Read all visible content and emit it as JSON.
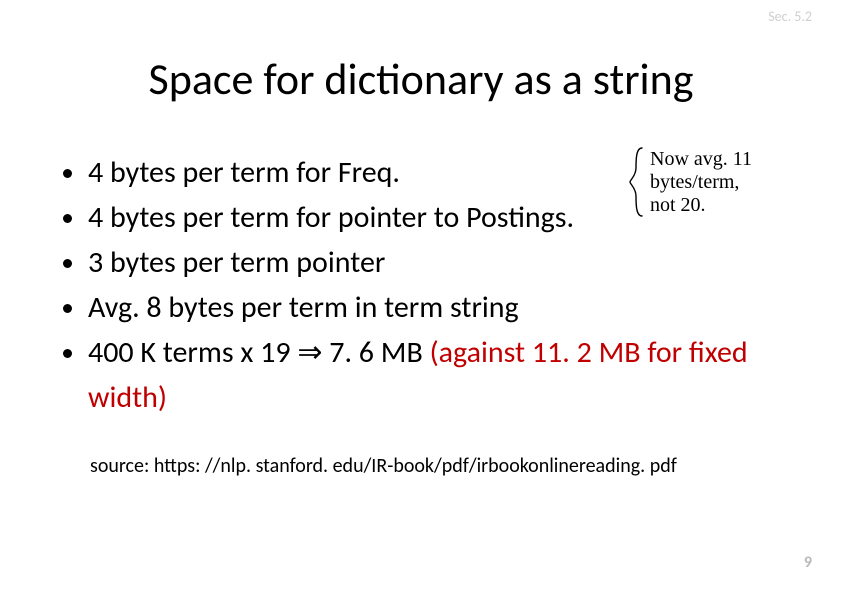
{
  "section_label": "Sec. 5.2",
  "title": "Space for dictionary as a string",
  "bullets": {
    "b1": "4 bytes per term for Freq.",
    "b2": "4 bytes per term for pointer to Postings.",
    "b3": "3 bytes per term pointer",
    "b4": "Avg. 8 bytes per term in term string",
    "b5a": "400 K terms x 19 ",
    "b5_arrow": "⇒",
    "b5b": " 7. 6 MB ",
    "b5c": "(against 11. 2 MB for fixed width)"
  },
  "annotation": {
    "line1": "Now avg. 11",
    "line2": "bytes/term,",
    "line3": "not 20."
  },
  "source": "source: https: //nlp. stanford. edu/IR-book/pdf/irbookonlinereading. pdf",
  "page_number": "9"
}
